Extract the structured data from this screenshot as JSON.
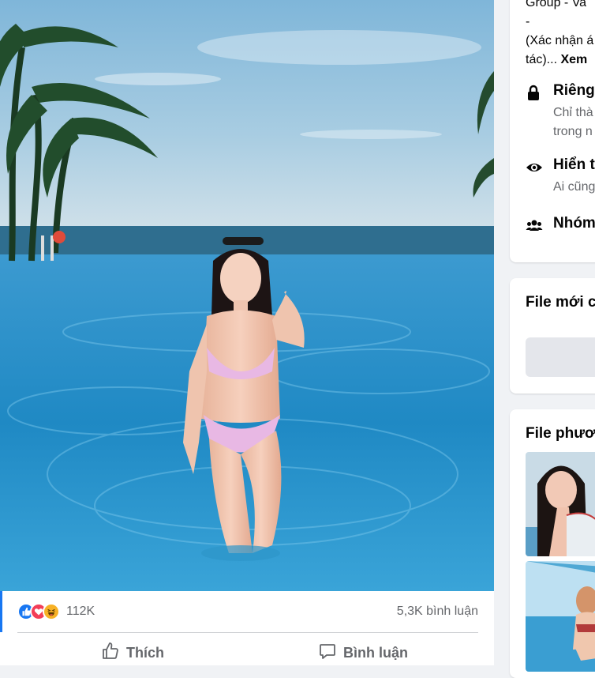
{
  "post": {
    "reaction_icons": [
      "like-icon",
      "love-icon",
      "haha-icon"
    ],
    "reaction_count": "112K",
    "comment_count": "5,3K bình luận",
    "like_label": "Thích",
    "comment_label": "Bình luận"
  },
  "sidebar": {
    "about": {
      "desc_line1": "Group - Va",
      "desc_line2": "-",
      "desc_line3": "(Xác nhận á",
      "desc_line4_prefix": "tác)...",
      "see_more": "Xem",
      "private_title": "Riêng",
      "private_sub1": "Chỉ thà",
      "private_sub2": "trong n",
      "visible_title": "Hiển t",
      "visible_sub": "Ai cũng",
      "group_title": "Nhóm"
    },
    "recent_files_title": "File mới c",
    "media_title": "File phươ"
  },
  "colors": {
    "accent": "#1877f2",
    "like": "#1877f2",
    "love": "#f33e58",
    "haha": "#f7b125",
    "muted": "#65676b"
  }
}
